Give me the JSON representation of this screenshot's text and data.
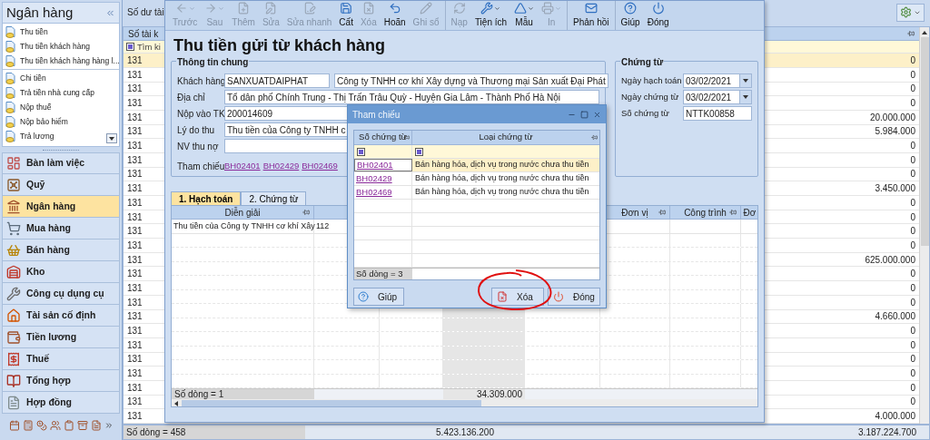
{
  "sidebar": {
    "title": "Ngân hàng",
    "groups": [
      [
        {
          "label": "Thu tiền"
        },
        {
          "label": "Thu tiền khách hàng"
        },
        {
          "label": "Thu tiền khách hàng hàng l..."
        }
      ],
      [
        {
          "label": "Chi tiền"
        },
        {
          "label": "Trả tiền nhà cung cấp"
        },
        {
          "label": "Nộp thuế"
        },
        {
          "label": "Nộp bảo hiểm"
        },
        {
          "label": "Trả lương"
        }
      ]
    ],
    "modules": [
      {
        "label": "Bàn làm việc",
        "selected": false
      },
      {
        "label": "Quỹ",
        "selected": false
      },
      {
        "label": "Ngân hàng",
        "selected": true
      },
      {
        "label": "Mua hàng",
        "selected": false
      },
      {
        "label": "Bán hàng",
        "selected": false
      },
      {
        "label": "Kho",
        "selected": false
      },
      {
        "label": "Công cụ dụng cụ",
        "selected": false
      },
      {
        "label": "Tài sản cố định",
        "selected": false
      },
      {
        "label": "Tiền lương",
        "selected": false
      },
      {
        "label": "Thuế",
        "selected": false
      },
      {
        "label": "Tổng hợp",
        "selected": false
      },
      {
        "label": "Hợp đồng",
        "selected": false
      }
    ]
  },
  "background_grid": {
    "tab_label": "Số dư tài",
    "column_1": "Số tài k",
    "filter_placeholder": "Tìm ki",
    "rows": [
      {
        "cells": [
          "131",
          "0"
        ],
        "selected": true
      },
      {
        "cells": [
          "131",
          "0"
        ],
        "selected": false
      },
      {
        "cells": [
          "131",
          "0"
        ],
        "selected": false
      },
      {
        "cells": [
          "131",
          "0"
        ],
        "selected": false
      },
      {
        "cells": [
          "131",
          "20.000.000"
        ],
        "selected": false
      },
      {
        "cells": [
          "131",
          "5.984.000"
        ],
        "selected": false
      },
      {
        "cells": [
          "131",
          "0"
        ],
        "selected": false
      },
      {
        "cells": [
          "131",
          "0"
        ],
        "selected": false
      },
      {
        "cells": [
          "131",
          "0"
        ],
        "selected": false
      },
      {
        "cells": [
          "131",
          "3.450.000"
        ],
        "selected": false
      },
      {
        "cells": [
          "131",
          "0"
        ],
        "selected": false
      },
      {
        "cells": [
          "131",
          "0"
        ],
        "selected": false
      },
      {
        "cells": [
          "131",
          "0"
        ],
        "selected": false
      },
      {
        "cells": [
          "131",
          "0"
        ],
        "selected": false
      },
      {
        "cells": [
          "131",
          "625.000.000"
        ],
        "selected": false
      },
      {
        "cells": [
          "131",
          "0"
        ],
        "selected": false
      },
      {
        "cells": [
          "131",
          "0"
        ],
        "selected": false
      },
      {
        "cells": [
          "131",
          "0"
        ],
        "selected": false
      },
      {
        "cells": [
          "131",
          "4.660.000"
        ],
        "selected": false
      },
      {
        "cells": [
          "131",
          "0"
        ],
        "selected": false
      },
      {
        "cells": [
          "131",
          "0"
        ],
        "selected": false
      },
      {
        "cells": [
          "131",
          "0"
        ],
        "selected": false
      },
      {
        "cells": [
          "131",
          "0"
        ],
        "selected": false
      },
      {
        "cells": [
          "131",
          "0"
        ],
        "selected": false
      },
      {
        "cells": [
          "131",
          "0"
        ],
        "selected": false
      },
      {
        "cells": [
          "131",
          "4.000.000"
        ],
        "selected": false
      }
    ],
    "status": {
      "count": "Số dòng = 458",
      "total_1": "5.423.136.200",
      "total_2": "3.187.224.700"
    }
  },
  "form": {
    "toolbar": [
      [
        {
          "label": "Trước",
          "disabled": true,
          "dropdown": true
        },
        {
          "label": "Sau",
          "disabled": true,
          "dropdown": true
        },
        {
          "label": "Thêm",
          "disabled": true,
          "dropdown": false
        },
        {
          "label": "Sửa",
          "disabled": true,
          "dropdown": false
        },
        {
          "label": "Sửa nhanh",
          "disabled": true,
          "dropdown": false
        },
        {
          "label": "Cất",
          "disabled": false,
          "dropdown": false
        },
        {
          "label": "Xóa",
          "disabled": true,
          "dropdown": false
        },
        {
          "label": "Hoãn",
          "disabled": false,
          "dropdown": false
        },
        {
          "label": "Ghi sổ",
          "disabled": true,
          "dropdown": false
        }
      ],
      [
        {
          "label": "Nạp",
          "disabled": true,
          "dropdown": false
        },
        {
          "label": "Tiện ích",
          "disabled": false,
          "dropdown": true
        },
        {
          "label": "Mẫu",
          "disabled": false,
          "dropdown": true
        },
        {
          "label": "In",
          "disabled": true,
          "dropdown": true
        }
      ],
      [
        {
          "label": "Phản hồi",
          "disabled": false,
          "dropdown": false
        }
      ],
      [
        {
          "label": "Giúp",
          "disabled": false,
          "dropdown": false
        },
        {
          "label": "Đóng",
          "disabled": false,
          "dropdown": false
        }
      ]
    ],
    "title": "Thu tiền gửi từ khách hàng",
    "general": {
      "title": "Thông tin chung",
      "fields": [
        {
          "label": "Khách hàng",
          "kind": "pair",
          "values": [
            "SANXUATDAIPHAT",
            "Công ty TNHH cơ khí Xây dựng và Thương mại Sản xuất Đại Phát"
          ]
        },
        {
          "label": "Địa chỉ",
          "kind": "text",
          "value": "Tổ dân phố Chính Trung - Thị Trấn Trâu Quỳ - Huyện Gia Lâm - Thành Phố Hà Nội"
        },
        {
          "label": "Nộp vào TK",
          "kind": "text",
          "value": "200014609"
        },
        {
          "label": "Lý do thu",
          "kind": "text",
          "value": "Thu tiền của Công ty TNHH c"
        },
        {
          "label": "NV thu nợ",
          "kind": "text"
        },
        {
          "label": "Tham chiếu",
          "kind": "links",
          "links": [
            "BH02401",
            "BH02429",
            "BH02469"
          ]
        }
      ]
    },
    "voucher": {
      "title": "Chứng từ",
      "fields": [
        {
          "label": "Ngày hạch toán",
          "kind": "date",
          "value": "03/02/2021"
        },
        {
          "label": "Ngày chứng từ",
          "kind": "date",
          "value": "03/02/2021"
        },
        {
          "label": "Số chứng từ",
          "kind": "text",
          "value": "NTTK00858"
        }
      ]
    },
    "tabs": [
      {
        "label": "1. Hạch toán",
        "selected": true
      },
      {
        "label": "2. Chứng từ",
        "selected": false
      }
    ],
    "grid": {
      "columns": [
        "Diễn giải",
        "Đơn vị",
        "Công trình",
        "Đơ"
      ],
      "rows": [
        {
          "cells": [
            "Thu tiền của Công ty TNHH cơ khí Xây",
            "112"
          ]
        }
      ],
      "footer": {
        "count": "Số dòng = 1",
        "amount": "34.309.000"
      }
    }
  },
  "dialog": {
    "title": "Tham chiếu",
    "columns": [
      "Số chứng từ",
      "Loại chứng từ"
    ],
    "rows": [
      {
        "number": "BH02401",
        "type": "Bán hàng hóa, dịch vụ trong nước chưa thu tiền",
        "selected": true
      },
      {
        "number": "BH02429",
        "type": "Bán hàng hóa, dịch vụ trong nước chưa thu tiền",
        "selected": false
      },
      {
        "number": "BH02469",
        "type": "Bán hàng hóa, dịch vụ trong nước chưa thu tiền",
        "selected": false
      }
    ],
    "footer": "Số dòng = 3",
    "buttons": [
      {
        "label": "Giúp",
        "kind": "help"
      },
      {
        "label": "Xóa",
        "kind": "delete"
      },
      {
        "label": "Đóng",
        "kind": "close"
      }
    ]
  }
}
